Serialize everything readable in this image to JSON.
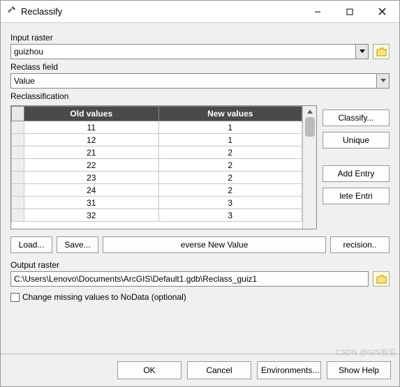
{
  "window": {
    "title": "Reclassify"
  },
  "labels": {
    "input_raster": "Input raster",
    "reclass_field": "Reclass field",
    "reclassification": "Reclassification",
    "output_raster": "Output raster",
    "change_missing": "Change missing values to NoData (optional)"
  },
  "values": {
    "input_raster": "guizhou",
    "reclass_field": "Value",
    "output_raster": "C:\\Users\\Lenovo\\Documents\\ArcGIS\\Default1.gdb\\Reclass_guiz1"
  },
  "table": {
    "headers": {
      "old": "Old values",
      "new": "New values"
    },
    "rows": [
      {
        "old": "11",
        "new": "1"
      },
      {
        "old": "12",
        "new": "1"
      },
      {
        "old": "21",
        "new": "2"
      },
      {
        "old": "22",
        "new": "2"
      },
      {
        "old": "23",
        "new": "2"
      },
      {
        "old": "24",
        "new": "2"
      },
      {
        "old": "31",
        "new": "3"
      },
      {
        "old": "32",
        "new": "3"
      }
    ]
  },
  "buttons": {
    "classify": "Classify...",
    "unique": "Unique",
    "add_entry": "Add Entry",
    "delete_entries": "lete Entri",
    "load": "Load...",
    "save": "Save...",
    "reverse": "everse New Value",
    "precision": "recision..",
    "ok": "OK",
    "cancel": "Cancel",
    "environments": "Environments...",
    "show_help": "Show Help"
  },
  "watermark": "CSDN @GIS前沿"
}
